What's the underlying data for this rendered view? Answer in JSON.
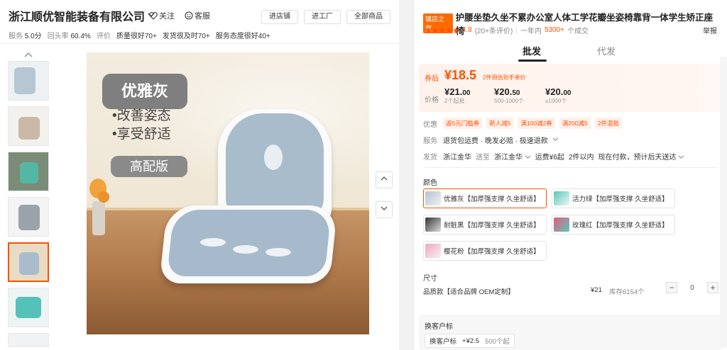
{
  "store": {
    "name": "浙江顺优智能装备有限公司",
    "follow_label": "关注",
    "service_label": "客服",
    "buttons": [
      "进店铺",
      "进工厂",
      "全部商品"
    ],
    "stats": {
      "service_label": "服务",
      "service_value": "5.0分",
      "repurchase_label": "回头率",
      "repurchase_value": "60.4%",
      "review_label": "评价",
      "review_tags": [
        "质量很好70+",
        "发货很及时70+",
        "服务态度很好40+"
      ]
    }
  },
  "gallery": {
    "thumbs_count": 7,
    "active_thumb_index": 4,
    "main_image": {
      "badge": "优雅灰",
      "features": [
        "•改善姿态",
        "•享受舒适"
      ],
      "badge2": "高配版"
    }
  },
  "product": {
    "store_tag": "镇店之宝",
    "title": "护腰坐垫久坐不累办公室人体工学花瓣坐姿椅靠背一体学生矫正座椅",
    "stars": "★★★★★",
    "rating": "4.8",
    "reviews": "(20+条评价)",
    "sales_prefix": "一年内",
    "sales_num": "5300+",
    "sales_suffix": "个成交",
    "report_label": "举报"
  },
  "tabs": [
    {
      "label": "批发",
      "active": true
    },
    {
      "label": "代发",
      "active": false
    }
  ],
  "price": {
    "coupon_label": "券后",
    "coupon_price": "¥18.5",
    "coupon_note": "2件预估到手单价",
    "price_label": "价格",
    "tiers": [
      {
        "price_main": "¥21.",
        "price_dec": "00",
        "qty": "2个起批"
      },
      {
        "price_main": "¥20.",
        "price_dec": "50",
        "qty": "500-1000个"
      },
      {
        "price_main": "¥20.",
        "price_dec": "00",
        "qty": "≥1000个"
      }
    ]
  },
  "promo": {
    "label": "优惠",
    "pills": [
      "返5元门槛券",
      "新人减5",
      "满100减2券",
      "满200减5",
      "2件混批"
    ]
  },
  "service": {
    "label": "服务",
    "text": "退货包运费 · 晚发必赔 · 极速退款"
  },
  "shipping": {
    "label": "发货",
    "from": "浙江金华",
    "to_label": "送至",
    "to": "浙江金华",
    "fee": "运费¥6起",
    "time": "2件以内",
    "estimate": "现在付款，预计后天送达"
  },
  "colors": {
    "title": "颜色",
    "options": [
      {
        "label": "优雅灰【加厚强支撑 久坐舒适】",
        "active": true
      },
      {
        "label": "活力绿【加厚强支撑 久坐舒适】",
        "active": false
      },
      {
        "label": "耐脏黑【加厚强支撑 久坐舒适】",
        "active": false
      },
      {
        "label": "玫瑰红【加厚强支撑 久坐舒适】",
        "active": false
      },
      {
        "label": "樱花粉【加厚强支撑 久坐舒适】",
        "active": false
      }
    ]
  },
  "size": {
    "title": "尺寸",
    "option_label": "品质款【适合品牌 OEM定制】",
    "price": "¥21",
    "stock": "库存6154个",
    "qty": "0",
    "minus": "−",
    "plus": "+"
  },
  "swap": {
    "title": "换客户标",
    "item_label": "换客户标",
    "item_price": "+¥2.5",
    "item_min": "500个起"
  },
  "accent_color": "#ff5000"
}
